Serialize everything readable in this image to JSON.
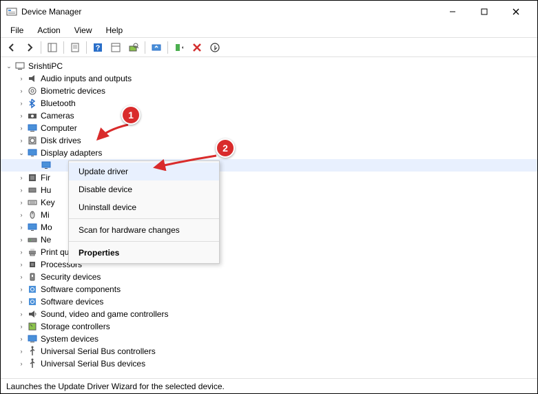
{
  "title": "Device Manager",
  "menu": {
    "file": "File",
    "action": "Action",
    "view": "View",
    "help": "Help"
  },
  "tree": {
    "root": "SrishtiPC",
    "nodes": [
      {
        "label": "Audio inputs and outputs",
        "icon": "audio"
      },
      {
        "label": "Biometric devices",
        "icon": "biometric"
      },
      {
        "label": "Bluetooth",
        "icon": "bluetooth"
      },
      {
        "label": "Cameras",
        "icon": "camera"
      },
      {
        "label": "Computer",
        "icon": "computer"
      },
      {
        "label": "Disk drives",
        "icon": "disk"
      },
      {
        "label": "Display adapters",
        "icon": "display",
        "expanded": true,
        "child": ""
      },
      {
        "label": "Fir",
        "icon": "firmware"
      },
      {
        "label": "Hu",
        "icon": "hid"
      },
      {
        "label": "Key",
        "icon": "keyboard"
      },
      {
        "label": "Mi",
        "icon": "mouse"
      },
      {
        "label": "Mo",
        "icon": "monitor"
      },
      {
        "label": "Ne",
        "icon": "network"
      },
      {
        "label": "Print queues",
        "icon": "printer"
      },
      {
        "label": "Processors",
        "icon": "cpu"
      },
      {
        "label": "Security devices",
        "icon": "security"
      },
      {
        "label": "Software components",
        "icon": "software"
      },
      {
        "label": "Software devices",
        "icon": "software"
      },
      {
        "label": "Sound, video and game controllers",
        "icon": "sound"
      },
      {
        "label": "Storage controllers",
        "icon": "storage"
      },
      {
        "label": "System devices",
        "icon": "system"
      },
      {
        "label": "Universal Serial Bus controllers",
        "icon": "usb"
      },
      {
        "label": "Universal Serial Bus devices",
        "icon": "usb"
      }
    ]
  },
  "context_menu": {
    "items": [
      {
        "label": "Update driver",
        "highlight": true
      },
      {
        "label": "Disable device"
      },
      {
        "label": "Uninstall device"
      },
      {
        "sep": true
      },
      {
        "label": "Scan for hardware changes"
      },
      {
        "sep": true
      },
      {
        "label": "Properties",
        "bold": true
      }
    ]
  },
  "statusbar": "Launches the Update Driver Wizard for the selected device.",
  "annotations": {
    "badge1": "1",
    "badge2": "2"
  }
}
